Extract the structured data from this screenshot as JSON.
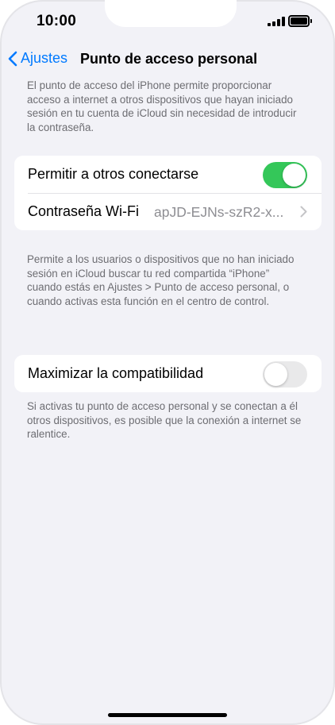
{
  "status_bar": {
    "time": "10:00"
  },
  "nav": {
    "back_label": "Ajustes",
    "title": "Punto de acceso personal"
  },
  "intro_text": "El punto de acceso del iPhone permite proporcionar acceso a internet a otros dispositivos que hayan iniciado sesión en tu cuenta de iCloud sin necesidad de introducir la contraseña.",
  "group1": {
    "allow_others_label": "Permitir a otros conectarse",
    "allow_others_on": true,
    "wifi_password_label": "Contraseña Wi-Fi",
    "wifi_password_value": "apJD-EJNs-szR2-x..."
  },
  "group1_footer": "Permite a los usuarios o dispositivos que no han iniciado sesión en iCloud buscar tu red compartida “iPhone” cuando estás en Ajustes > Punto de acceso personal, o cuando activas esta función en el centro de control.",
  "group2": {
    "maximize_label": "Maximizar la compatibilidad",
    "maximize_on": false
  },
  "group2_footer": "Si activas tu punto de acceso personal y se conectan a él otros dispositivos, es posible que la conexión a internet se ralentice.",
  "colors": {
    "accent": "#007aff",
    "toggle_on": "#34c759",
    "toggle_off": "#e9e9ea",
    "background": "#f2f2f7"
  },
  "icons": {
    "back": "chevron-left-icon",
    "disclosure": "chevron-right-icon",
    "signal": "cellular-signal-icon",
    "battery": "battery-icon"
  }
}
